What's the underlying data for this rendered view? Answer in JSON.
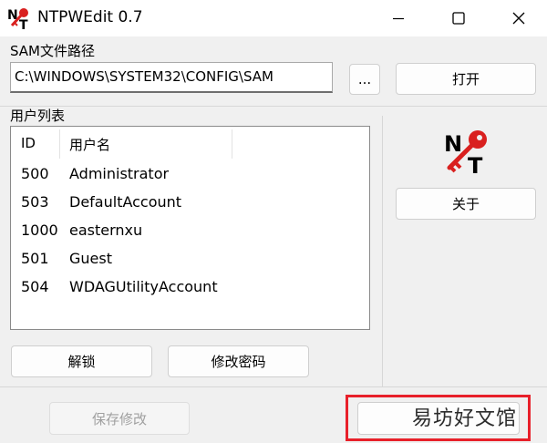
{
  "window": {
    "title": "NTPWEdit 0.7"
  },
  "sam": {
    "group_label": "SAM文件路径",
    "path_value": "C:\\WINDOWS\\SYSTEM32\\CONFIG\\SAM",
    "browse_label": "...",
    "open_label": "打开"
  },
  "users": {
    "group_label": "用户列表",
    "columns": {
      "id": "ID",
      "name": "用户名"
    },
    "rows": [
      {
        "id": "500",
        "name": "Administrator"
      },
      {
        "id": "503",
        "name": "DefaultAccount"
      },
      {
        "id": "1000",
        "name": "easternxu"
      },
      {
        "id": "501",
        "name": "Guest"
      },
      {
        "id": "504",
        "name": "WDAGUtilityAccount"
      }
    ],
    "unlock_label": "解锁",
    "change_password_label": "修改密码"
  },
  "about_label": "关于",
  "save_label": "保存修改",
  "watermark": "易坊好文馆",
  "colors": {
    "highlight": "#e8202a",
    "logo_red": "#d9201f"
  }
}
